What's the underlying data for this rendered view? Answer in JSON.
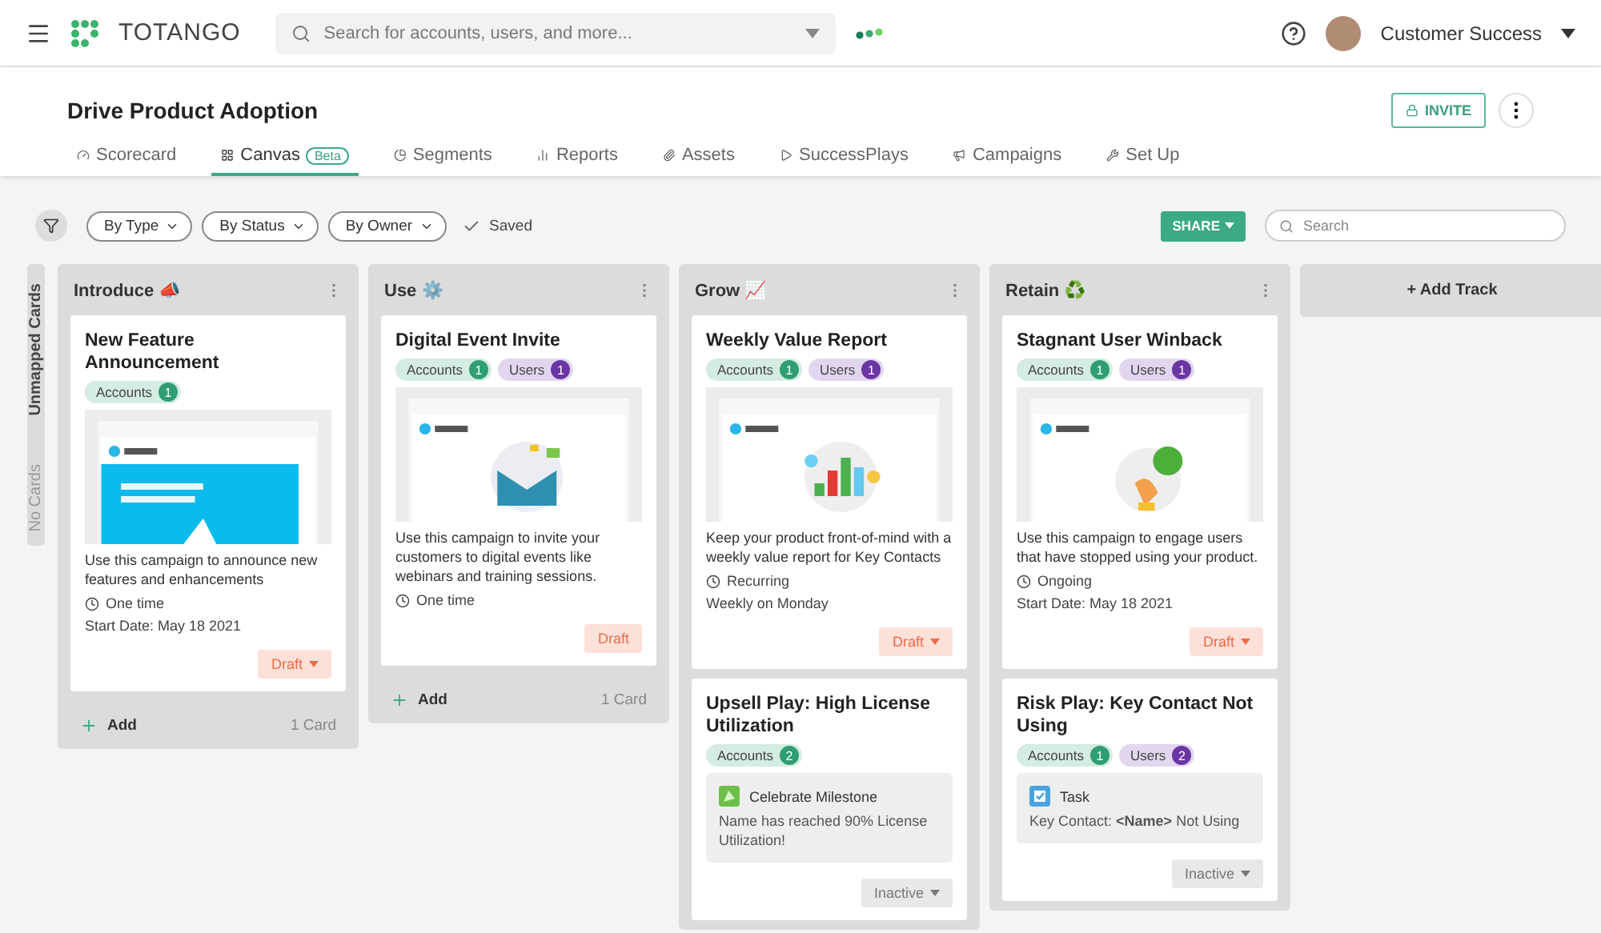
{
  "topbar": {
    "brand": "TOTANGO",
    "search_placeholder": "Search for accounts, users, and more...",
    "user": "Customer Success"
  },
  "header": {
    "title": "Drive Product Adoption",
    "invite": "INVITE"
  },
  "tabs": [
    {
      "label": "Scorecard",
      "selected": false
    },
    {
      "label": "Canvas",
      "badge": "Beta",
      "selected": true
    },
    {
      "label": "Segments",
      "selected": false
    },
    {
      "label": "Reports",
      "selected": false
    },
    {
      "label": "Assets",
      "selected": false
    },
    {
      "label": "SuccessPlays",
      "selected": false
    },
    {
      "label": "Campaigns",
      "selected": false
    },
    {
      "label": "Set Up",
      "selected": false
    }
  ],
  "toolbar": {
    "filters": [
      "By Type",
      "By Status",
      "By Owner"
    ],
    "saved": "Saved",
    "share": "SHARE",
    "search_placeholder": "Search"
  },
  "unmapped": {
    "title": "Unmapped Cards",
    "empty": "No Cards"
  },
  "tracks": [
    {
      "title": "Introduce",
      "emoji": "📣",
      "add": "Add",
      "count": "1 Card",
      "cards": [
        {
          "kind": "campaign",
          "title": "New Feature Announcement",
          "audiences": [
            {
              "kind": "accounts",
              "label": "Accounts",
              "count": "1"
            }
          ],
          "preview": {
            "kind": "picture"
          },
          "description": "Use this campaign to announce new features and enhancements",
          "schedule": "One time",
          "detail": "Start Date: May 18 2021",
          "status": {
            "kind": "draft",
            "label": "Draft",
            "dropdown": true
          }
        }
      ]
    },
    {
      "title": "Use",
      "emoji": "⚙️",
      "add": "Add",
      "count": "1 Card",
      "cards": [
        {
          "kind": "campaign",
          "title": "Digital Event Invite",
          "audiences": [
            {
              "kind": "accounts",
              "label": "Accounts",
              "count": "1"
            },
            {
              "kind": "users",
              "label": "Users",
              "count": "1"
            }
          ],
          "preview": {
            "kind": "picture"
          },
          "description": "Use this campaign to invite your customers to digital events like webinars and training sessions.",
          "schedule": "One time",
          "status": {
            "kind": "draft",
            "label": "Draft",
            "dropdown": false
          }
        }
      ]
    },
    {
      "title": "Grow",
      "emoji": "📈",
      "cards": [
        {
          "kind": "campaign",
          "title": "Weekly Value Report",
          "audiences": [
            {
              "kind": "accounts",
              "label": "Accounts",
              "count": "1"
            },
            {
              "kind": "users",
              "label": "Users",
              "count": "1"
            }
          ],
          "preview": {
            "kind": "picture"
          },
          "description": "Keep your product front-of-mind with a weekly value report for Key Contacts",
          "schedule": "Recurring",
          "detail": "Weekly on Monday",
          "status": {
            "kind": "draft",
            "label": "Draft",
            "dropdown": true
          }
        },
        {
          "kind": "play",
          "title": "Upsell Play: High License Utilization",
          "audiences": [
            {
              "kind": "accounts",
              "label": "Accounts",
              "count": "2"
            }
          ],
          "action": {
            "kind": "milestone",
            "title": "Celebrate Milestone",
            "text": "Name has reached 90% License Utilization!"
          },
          "status": {
            "kind": "inactive",
            "label": "Inactive",
            "dropdown": true
          }
        }
      ]
    },
    {
      "title": "Retain",
      "emoji": "♻️",
      "cards": [
        {
          "kind": "campaign",
          "title": "Stagnant User Winback",
          "audiences": [
            {
              "kind": "accounts",
              "label": "Accounts",
              "count": "1"
            },
            {
              "kind": "users",
              "label": "Users",
              "count": "1"
            }
          ],
          "preview": {
            "kind": "picture"
          },
          "description": "Use this campaign to engage users that have stopped using your product.",
          "schedule": "Ongoing",
          "detail": "Start Date: May 18 2021",
          "status": {
            "kind": "draft",
            "label": "Draft",
            "dropdown": true
          }
        },
        {
          "kind": "play",
          "title": "Risk Play: Key Contact Not Using",
          "audiences": [
            {
              "kind": "accounts",
              "label": "Accounts",
              "count": "1"
            },
            {
              "kind": "users",
              "label": "Users",
              "count": "2"
            }
          ],
          "action": {
            "kind": "task",
            "title": "Task",
            "text": "Key Contact: **<Name>** Not Using"
          },
          "status": {
            "kind": "inactive",
            "label": "Inactive",
            "dropdown": true
          }
        }
      ]
    }
  ],
  "add_track": "+ Add Track"
}
